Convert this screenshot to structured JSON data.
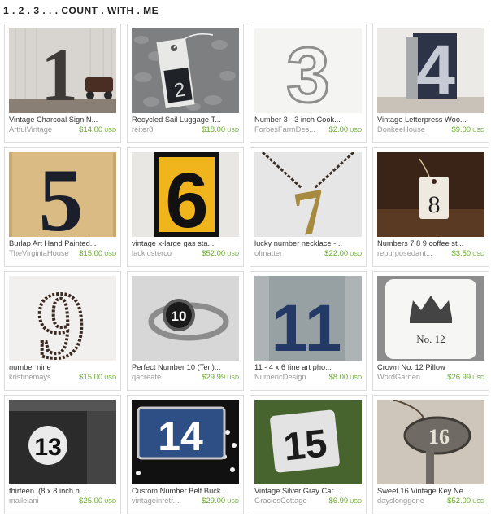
{
  "page": {
    "title": "1 . 2 . 3 . . . COUNT . WITH . ME"
  },
  "items": [
    {
      "title": "Vintage Charcoal Sign N...",
      "shop": "ArtfulVintage",
      "price": "$14.00",
      "currency": "USD",
      "digit": "1"
    },
    {
      "title": "Recycled Sail Luggage T...",
      "shop": "reiter8",
      "price": "$18.00",
      "currency": "USD",
      "digit": "2"
    },
    {
      "title": "Number 3 - 3 inch Cook...",
      "shop": "ForbesFarmDes...",
      "price": "$2.00",
      "currency": "USD",
      "digit": "3"
    },
    {
      "title": "Vintage Letterpress Woo...",
      "shop": "DonkeeHouse",
      "price": "$9.00",
      "currency": "USD",
      "digit": "4"
    },
    {
      "title": "Burlap Art Hand Painted...",
      "shop": "TheVirginiaHouse",
      "price": "$15.00",
      "currency": "USD",
      "digit": "5"
    },
    {
      "title": "vintage x-large gas sta...",
      "shop": "lacklusterco",
      "price": "$52.00",
      "currency": "USD",
      "digit": "6"
    },
    {
      "title": "lucky number necklace -...",
      "shop": "ofmatter",
      "price": "$22.00",
      "currency": "USD",
      "digit": "7"
    },
    {
      "title": "Numbers 7 8 9 coffee st...",
      "shop": "repurposedant...",
      "price": "$3.50",
      "currency": "USD",
      "digit": "8"
    },
    {
      "title": "number nine",
      "shop": "kristinemays",
      "price": "$15.00",
      "currency": "USD",
      "digit": "9"
    },
    {
      "title": "Perfect Number 10 (Ten)...",
      "shop": "qacreate",
      "price": "$29.99",
      "currency": "USD",
      "digit": "10"
    },
    {
      "title": "11 - 4 x 6 fine art pho...",
      "shop": "NumericDesign",
      "price": "$8.00",
      "currency": "USD",
      "digit": "11"
    },
    {
      "title": "Crown No. 12 Pillow",
      "shop": "WordGarden",
      "price": "$26.99",
      "currency": "USD",
      "digit": "12",
      "pillow_text": "No. 12"
    },
    {
      "title": "thirteen. (8 x 8 inch h...",
      "shop": "maileiani",
      "price": "$25.00",
      "currency": "USD",
      "digit": "13"
    },
    {
      "title": "Custom Number Belt Buck...",
      "shop": "vintageinretr...",
      "price": "$29.00",
      "currency": "USD",
      "digit": "14"
    },
    {
      "title": "Vintage Silver Gray Car...",
      "shop": "GraciesCottage",
      "price": "$6.99",
      "currency": "USD",
      "digit": "15"
    },
    {
      "title": "Sweet 16 Vintage Key Ne...",
      "shop": "dayslonggone",
      "price": "$52.00",
      "currency": "USD",
      "digit": "16"
    }
  ],
  "colors": {
    "price": "#6aaa2f",
    "shop": "#999999",
    "border": "#dcdcdc"
  }
}
